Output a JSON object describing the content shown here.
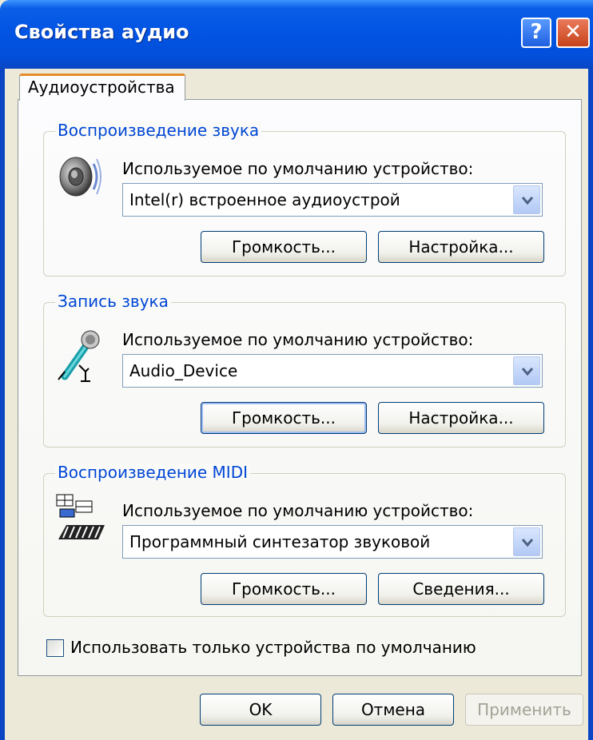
{
  "window": {
    "title": "Свойства аудио",
    "help_label": "?",
    "close_label": "✕"
  },
  "tabs": [
    {
      "label": "Аудиоустройства",
      "selected": true
    }
  ],
  "playback": {
    "group_title": "Воспроизведение звука",
    "device_label": "Используемое по умолчанию устройство:",
    "device_value": "Intel(r) встроенное аудиоустрой",
    "icon": "speaker-icon",
    "volume_label": "Громкость...",
    "settings_label": "Настройка..."
  },
  "recording": {
    "group_title": "Запись звука",
    "device_label": "Используемое по умолчанию устройство:",
    "device_value": "Audio_Device",
    "icon": "microphone-icon",
    "volume_label": "Громкость...",
    "settings_label": "Настройка..."
  },
  "midi": {
    "group_title": "Воспроизведение MIDI",
    "device_label": "Используемое по умолчанию устройство:",
    "device_value": "Программный синтезатор звуковой",
    "icon": "midi-keyboard-icon",
    "volume_label": "Громкость...",
    "info_label": "Сведения..."
  },
  "default_only": {
    "label": "Использовать только устройства по умолчанию",
    "checked": false
  },
  "footer": {
    "ok_label": "OK",
    "cancel_label": "Отмена",
    "apply_label": "Применить"
  },
  "colors": {
    "titlebar": "#0254e3",
    "group_title": "#0046d5",
    "tab_highlight": "#e68b2c"
  }
}
